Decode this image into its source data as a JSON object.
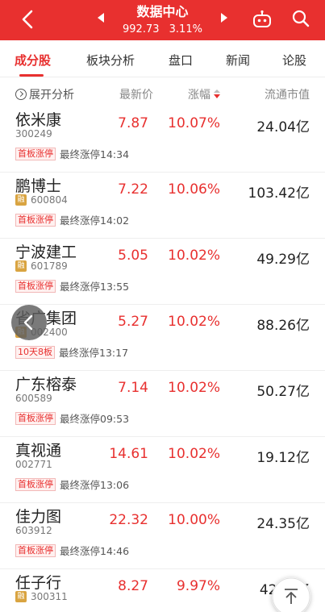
{
  "header": {
    "title": "数据中心",
    "index_value": "992.73",
    "index_change": "3.11%",
    "icons": [
      "back-icon",
      "prev-arrow-icon",
      "next-arrow-icon",
      "robot-icon",
      "search-icon"
    ]
  },
  "tabs": [
    {
      "label": "成分股",
      "active": true
    },
    {
      "label": "板块分析",
      "active": false
    },
    {
      "label": "盘口",
      "active": false
    },
    {
      "label": "新闻",
      "active": false
    },
    {
      "label": "论股",
      "active": false
    }
  ],
  "columns": {
    "expand": "展开分析",
    "price": "最新价",
    "change": "涨幅",
    "cap": "流通市值"
  },
  "stocks": [
    {
      "name": "依米康",
      "code": "300249",
      "rong": "",
      "price": "7.87",
      "change": "10.07%",
      "cap": "24.04亿",
      "tag": "首板涨停",
      "note": "最终涨停14:34"
    },
    {
      "name": "鹏博士",
      "code": "600804",
      "rong": "融",
      "price": "7.22",
      "change": "10.06%",
      "cap": "103.42亿",
      "tag": "首板涨停",
      "note": "最终涨停14:02"
    },
    {
      "name": "宁波建工",
      "code": "601789",
      "rong": "融",
      "price": "5.05",
      "change": "10.02%",
      "cap": "49.29亿",
      "tag": "首板涨停",
      "note": "最终涨停13:55"
    },
    {
      "name": "省广集团",
      "code": "002400",
      "rong": "融",
      "price": "5.27",
      "change": "10.02%",
      "cap": "88.26亿",
      "tag": "10天8板",
      "note": "最终涨停13:17"
    },
    {
      "name": "广东榕泰",
      "code": "600589",
      "rong": "",
      "price": "7.14",
      "change": "10.02%",
      "cap": "50.27亿",
      "tag": "首板涨停",
      "note": "最终涨停09:53"
    },
    {
      "name": "真视通",
      "code": "002771",
      "rong": "",
      "price": "14.61",
      "change": "10.02%",
      "cap": "19.12亿",
      "tag": "首板涨停",
      "note": "最终涨停13:06"
    },
    {
      "name": "佳力图",
      "code": "603912",
      "rong": "",
      "price": "22.32",
      "change": "10.00%",
      "cap": "24.35亿",
      "tag": "首板涨停",
      "note": "最终涨停14:46"
    },
    {
      "name": "任子行",
      "code": "300311",
      "rong": "融",
      "price": "8.27",
      "change": "9.97%",
      "cap": "42.??亿",
      "tag": "",
      "note": ""
    }
  ],
  "colors": {
    "accent": "#e8302f",
    "up": "#e8302f",
    "rong": "#d9a441"
  }
}
